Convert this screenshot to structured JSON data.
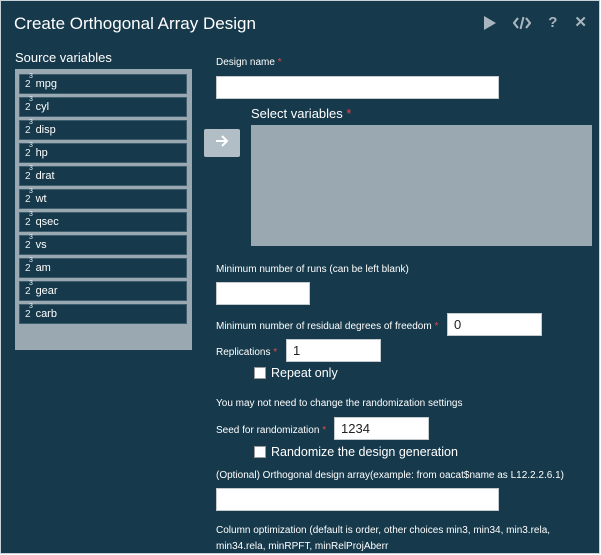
{
  "window": {
    "title": "Create Orthogonal Array Design",
    "toolbar": [
      {
        "name": "run-icon",
        "glyph": "play"
      },
      {
        "name": "code-icon",
        "glyph": "code"
      },
      {
        "name": "help-icon",
        "glyph": "?"
      },
      {
        "name": "close-icon",
        "glyph": "✕"
      }
    ]
  },
  "source": {
    "label": "Source variables",
    "items": [
      {
        "label": "mpg"
      },
      {
        "label": "cyl"
      },
      {
        "label": "disp"
      },
      {
        "label": "hp"
      },
      {
        "label": "drat"
      },
      {
        "label": "wt"
      },
      {
        "label": "qsec"
      },
      {
        "label": "vs"
      },
      {
        "label": "am"
      },
      {
        "label": "gear"
      },
      {
        "label": "carb"
      }
    ],
    "icon_glyph": "2",
    "icon_sup": "3"
  },
  "form": {
    "design_name_label": "Design name",
    "design_name_value": "",
    "select_vars_label": "Select variables",
    "min_runs_label": "Minimum number of runs (can be left blank)",
    "min_runs_value": "",
    "min_resid_label": "Minimum number of residual degrees of freedom",
    "min_resid_value": "0",
    "replications_label": "Replications",
    "replications_value": "1",
    "repeat_only_label": "Repeat only",
    "repeat_only_checked": false,
    "random_note": "You may not need to change the randomization settings",
    "seed_label": "Seed for randomization",
    "seed_value": "1234",
    "randomize_label": "Randomize the design generation",
    "randomize_checked": false,
    "array_label": "(Optional) Orthogonal design array(example: from oacat$name as L12.2.2.6.1)",
    "array_value": "",
    "column_opt_label_1": "Column optimization (default is order, other choices min3, min34, min3.rela,",
    "column_opt_label_2": "min34.rela, minRPFT, minRelProjAberr",
    "required_mark": "*"
  },
  "colors": {
    "background": "#16394b",
    "panel": "#9aa9b1",
    "required": "#e24b4b",
    "arrow_button": "#b2bec5"
  }
}
